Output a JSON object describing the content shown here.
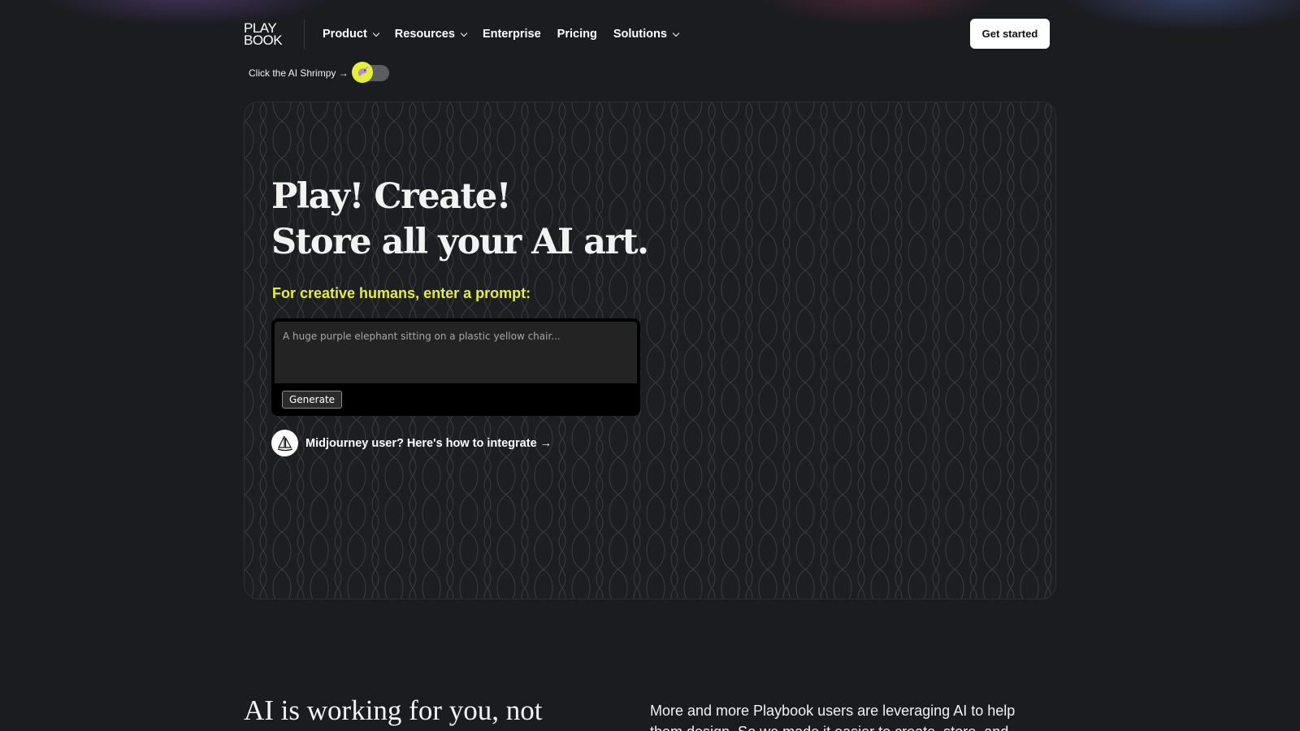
{
  "nav": {
    "logo_line1": "PLAY",
    "logo_line2": "BOOK",
    "items": [
      {
        "label": "Product",
        "has_dropdown": true
      },
      {
        "label": "Resources",
        "has_dropdown": true
      },
      {
        "label": "Enterprise",
        "has_dropdown": false
      },
      {
        "label": "Pricing",
        "has_dropdown": false
      },
      {
        "label": "Solutions",
        "has_dropdown": true
      }
    ],
    "cta_label": "Get started"
  },
  "shrimpy": {
    "label": "Click the AI Shrimpy →",
    "toggle_on": false
  },
  "hero": {
    "title_line1": "Play! Create!",
    "title_line2": "Store all your AI art.",
    "prompt_label": "For creative humans, enter a prompt:",
    "prompt_placeholder": "A huge purple elephant sitting on a plastic yellow chair...",
    "prompt_value": "",
    "generate_label": "Generate",
    "midjourney_link": "Midjourney user? Here's how to integrate →"
  },
  "section2": {
    "heading": "AI is working for you, not",
    "paragraph": "More and more Playbook users are leveraging AI to help them design. So we made it easier to create, store, and"
  },
  "colors": {
    "background": "#1b1c20",
    "accent_yellow": "#e4ef3a",
    "text": "#ffffff"
  },
  "icons": [
    "chevron-down-icon",
    "shrimp-icon",
    "midjourney-sailboat-icon"
  ]
}
